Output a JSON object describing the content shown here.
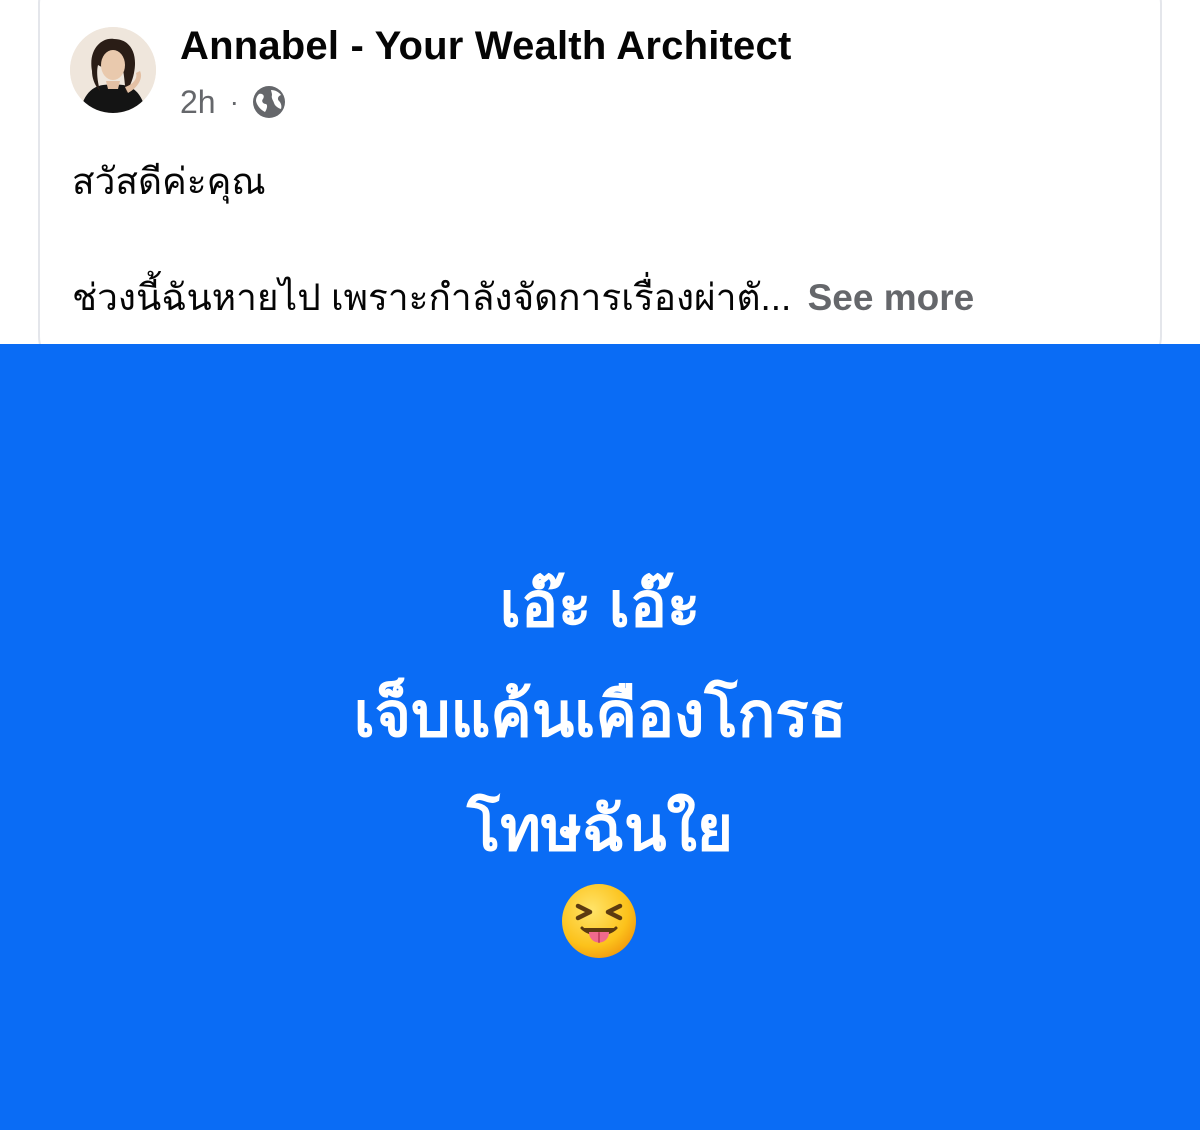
{
  "post": {
    "author": "Annabel - Your Wealth Architect",
    "time": "2h",
    "separator": "·",
    "audience_icon": "globe-icon",
    "greeting": "สวัสดีค่ะคุณ",
    "preview": "ช่วงนี้ฉันหายไป เพราะกำลังจัดการเรื่องผ่าตั...",
    "see_more_label": "See more"
  },
  "image_post": {
    "background_color": "#0a6cf5",
    "lines": [
      "เอ๊ะ เอ๊ะ",
      "เจ็บแค้นเคืองโกรธ",
      "โทษฉันใย"
    ],
    "emoji": "squinting-face-with-tongue-icon"
  },
  "colors": {
    "text_primary": "#050505",
    "text_secondary": "#65676b",
    "card_border": "#e4e6eb"
  }
}
